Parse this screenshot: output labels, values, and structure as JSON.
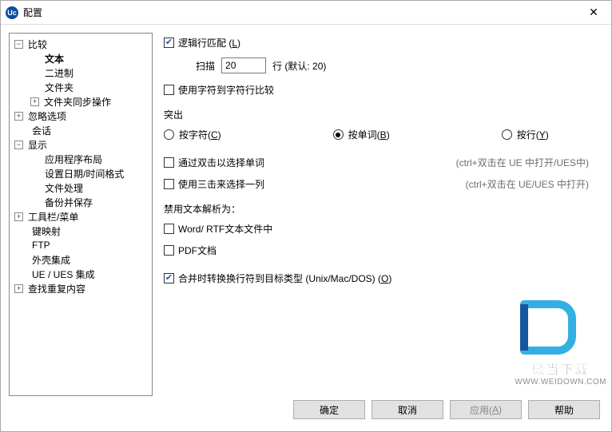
{
  "window": {
    "title": "配置",
    "icon_text": "Uc"
  },
  "tree": {
    "compare": {
      "label": "比较",
      "expanded": true,
      "children": {
        "text": {
          "label": "文本",
          "selected": true
        },
        "binary": {
          "label": "二进制"
        },
        "folder": {
          "label": "文件夹"
        },
        "foldersync": {
          "label": "文件夹同步操作",
          "hasToggle": true,
          "expanded": false
        }
      }
    },
    "ignore": {
      "label": "忽略选项",
      "hasToggle": true,
      "expanded": false
    },
    "session": {
      "label": "会话"
    },
    "display": {
      "label": "显示",
      "hasToggle": true,
      "expanded": true,
      "children": {
        "layout": {
          "label": "应用程序布局"
        },
        "datetime": {
          "label": "设置日期/时间格式"
        },
        "filehandle": {
          "label": "文件处理"
        },
        "backupsave": {
          "label": "备份并保存"
        }
      }
    },
    "toolbar": {
      "label": "工具栏/菜单",
      "hasToggle": true,
      "expanded": false
    },
    "keymap": {
      "label": "键映射"
    },
    "ftp": {
      "label": "FTP"
    },
    "shell": {
      "label": "外壳集成"
    },
    "ueues": {
      "label": "UE / UES  集成"
    },
    "finddup": {
      "label": "查找重复内容",
      "hasToggle": true,
      "expanded": false
    }
  },
  "form": {
    "logical_match": {
      "label_pre": "逻辑行匹配 (",
      "accel": "L",
      "label_post": ")",
      "checked": true
    },
    "scan": {
      "label": "扫描",
      "value": "20",
      "suffix": "行 (默认: 20)"
    },
    "char_by_char": {
      "label": "使用字符到字符行比较",
      "checked": false
    },
    "highlight_label": "突出",
    "radio": {
      "bychar": {
        "pre": "按字符(",
        "accel": "C",
        "post": ")"
      },
      "byword": {
        "pre": "按单词(",
        "accel": "B",
        "post": ")"
      },
      "byline": {
        "pre": "按行(",
        "accel": "Y",
        "post": ")"
      },
      "selected": "byword"
    },
    "dblclick_word": {
      "label": "通过双击以选择单词",
      "hint": "(ctrl+双击在 UE 中打开/UES中)",
      "checked": false
    },
    "triple_line": {
      "label": "使用三击来选择一列",
      "hint": "(ctrl+双击在 UE/UES 中打开)",
      "checked": false
    },
    "disable_parse_label": "禁用文本解析为：",
    "word_rtf": {
      "label": "Word/ RTF文本文件中",
      "checked": false
    },
    "pdf": {
      "label": "PDF文档",
      "checked": false
    },
    "merge_eol": {
      "label_pre": "合并时转换换行符到目标类型 (Unix/Mac/DOS) (",
      "accel": "O",
      "label_post": ")",
      "checked": true
    }
  },
  "buttons": {
    "ok": "确定",
    "cancel": "取消",
    "apply_pre": "应用(",
    "apply_accel": "A",
    "apply_post": ")",
    "help": "帮助"
  },
  "watermark": {
    "line1": "微当下载",
    "line2": "WWW.WEIDOWN.COM"
  }
}
